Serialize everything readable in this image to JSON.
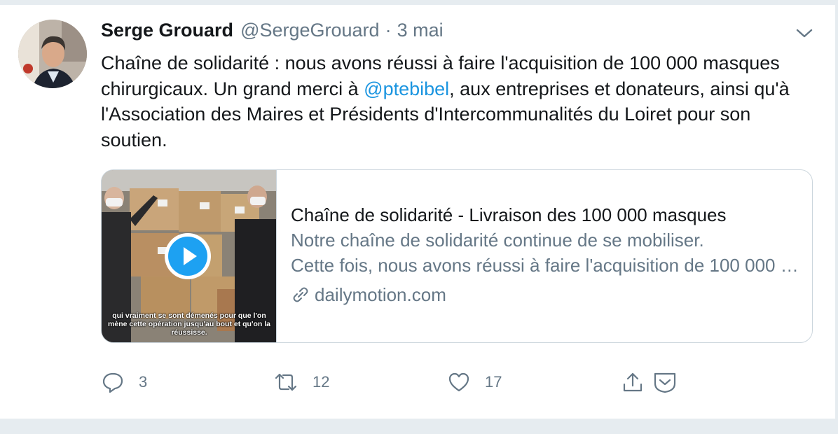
{
  "tweet": {
    "name": "Serge Grouard",
    "handle": "@SergeGrouard",
    "separator": "·",
    "date": "3 mai",
    "text_part1": "Chaîne de solidarité : nous avons réussi à faire l'acquisition de 100 000 masques chirurgicaux. Un grand merci à ",
    "mention": "@ptebibel",
    "text_part2": ", aux entreprises et donateurs, ainsi qu'à l'Association des Maires et Présidents d'Intercommunalités du Loiret pour son soutien."
  },
  "card": {
    "title": "Chaîne de solidarité - Livraison des 100 000 masques",
    "description_line1": "Notre chaîne de solidarité continue de se mobiliser.",
    "description_line2": "Cette fois, nous avons réussi à faire l'acquisition de 100 000 masques",
    "domain": "dailymotion.com",
    "video_caption": "qui vraiment se sont démenés pour que l'on mène cette opération jusqu'au bout et qu'on la réussisse."
  },
  "actions": {
    "replies": "3",
    "retweets": "12",
    "likes": "17"
  },
  "icons": [
    "chevron-down-icon",
    "play-icon",
    "link-icon",
    "reply-icon",
    "retweet-icon",
    "like-icon",
    "share-icon",
    "tip-jar-icon"
  ],
  "colors": {
    "link": "#1b95e0",
    "secondary_text": "#657786",
    "play_button": "#1da1f2",
    "border": "#ccd6dd"
  }
}
